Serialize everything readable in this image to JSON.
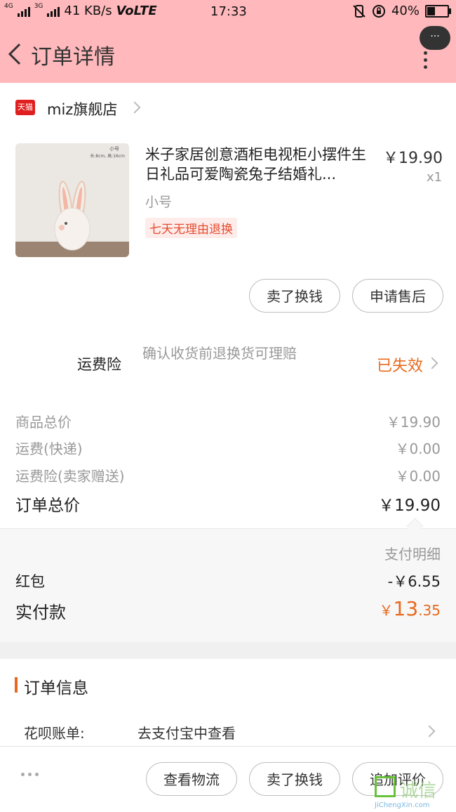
{
  "status_bar": {
    "net_left": "4G",
    "net_right": "3G",
    "speed": "41 KB/s",
    "volte": "VoLTE",
    "time": "17:33",
    "battery": "40%"
  },
  "header": {
    "title": "订单详情",
    "more_bubble": "···"
  },
  "shop": {
    "logo_text": "天猫",
    "name": "miz旗舰店"
  },
  "product": {
    "image_caption_line1": "小号",
    "image_caption_line2": "长:8cm, 高:16cm",
    "title": "米子家居创意酒柜电视柜小摆件生日礼品可爱陶瓷兔子结婚礼...",
    "price": "￥19.90",
    "qty": "x1",
    "spec": "小号",
    "tag": "七天无理由退换"
  },
  "item_actions": {
    "sell": "卖了换钱",
    "after_sale": "申请售后"
  },
  "insurance": {
    "label": "运费险",
    "desc": "确认收货前退换货可理赔",
    "status": "已失效"
  },
  "price_rows": [
    {
      "label": "商品总价",
      "value": "￥19.90"
    },
    {
      "label": "运费(快递)",
      "value": "￥0.00"
    },
    {
      "label": "运费险(卖家赠送)",
      "value": "￥0.00"
    }
  ],
  "total": {
    "label": "订单总价",
    "value": "￥19.90"
  },
  "payment": {
    "detail_label": "支付明细",
    "red_label": "红包",
    "red_value": "-￥6.55",
    "paid_label": "实付款",
    "paid_currency": "￥",
    "paid_int": "13",
    "paid_dec": ".35"
  },
  "order_info": {
    "title": "订单信息",
    "huabei_label": "花呗账单:",
    "huabei_value": "去支付宝中查看"
  },
  "bottom_bar": {
    "logistics": "查看物流",
    "sell": "卖了换钱",
    "review": "追加评价"
  },
  "watermark": {
    "text": "诚信",
    "url": "JiChengXin.com"
  },
  "colors": {
    "header_bg": "#ffb8bb",
    "accent": "#e8691d",
    "tmall_red": "#e02020"
  }
}
